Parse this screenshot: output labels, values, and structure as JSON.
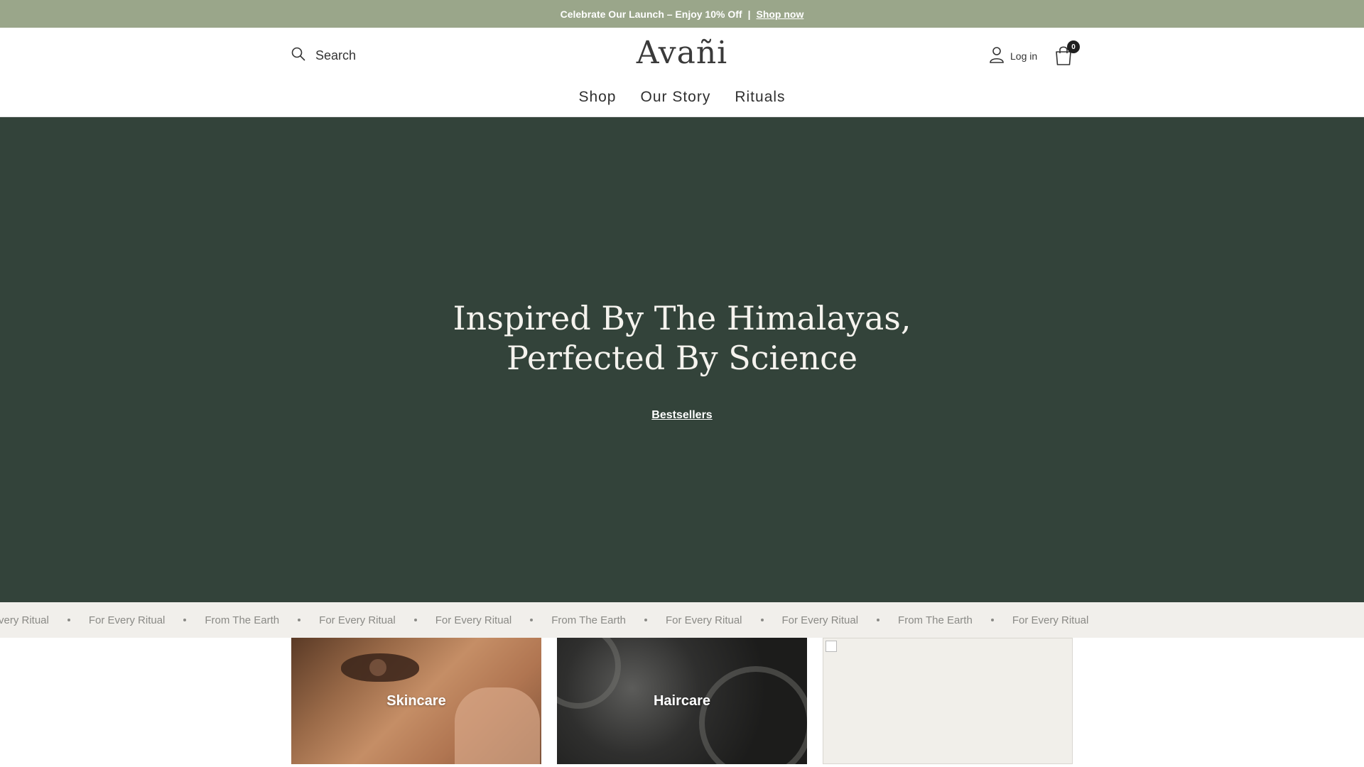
{
  "announcement": {
    "text": "Celebrate Our Launch – Enjoy 10% Off",
    "separator": "|",
    "link_label": "Shop now"
  },
  "header": {
    "search_label": "Search",
    "logo_text": "Avañi",
    "login_label": "Log in",
    "cart_count": "0",
    "nav": [
      "Shop",
      "Our Story",
      "Rituals"
    ]
  },
  "hero": {
    "title_line1": "Inspired By The Himalayas,",
    "title_line2": "Perfected By Science",
    "cta_label": "Bestsellers"
  },
  "marquee": {
    "items": [
      "Every Ritual",
      "For Every Ritual",
      "From The Earth",
      "For Every Ritual",
      "For Every Ritual",
      "From The Earth",
      "For Every Ritual",
      "For Every Ritual",
      "From The Earth",
      "For Every Ritual"
    ]
  },
  "categories": [
    {
      "label": "Skincare"
    },
    {
      "label": "Haircare"
    },
    {
      "label": ""
    }
  ],
  "colors": {
    "announcement_bg": "#9aa68a",
    "hero_bg": "#33433a",
    "marquee_bg": "#f1efeb"
  }
}
